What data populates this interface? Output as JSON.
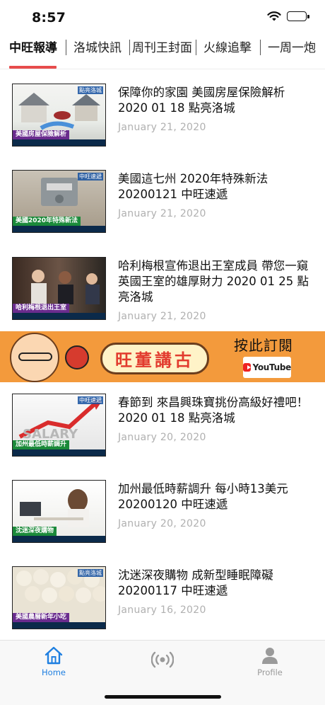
{
  "status": {
    "time": "8:57"
  },
  "tabs": [
    {
      "label": "中旺報導",
      "active": true
    },
    {
      "label": "洛城快訊",
      "active": false
    },
    {
      "label": "周刊王封面",
      "active": false
    },
    {
      "label": "火線追擊",
      "active": false
    },
    {
      "label": "一周一炮",
      "active": false
    }
  ],
  "articles": [
    {
      "title": "保障你的家園 美國房屋保險解析 2020 01 18 點亮洛城",
      "date": "January 21, 2020",
      "thumb_banner": "美國房屋保險解析"
    },
    {
      "title": "美國這七州 2020年特殊新法 20200121 中旺速遞",
      "date": "January 21, 2020",
      "thumb_banner": "美國2020年特殊新法"
    },
    {
      "title": "哈利梅根宣佈退出王室成員 帶您一窺英國王室的雄厚財力 2020 01 25 點亮洛城",
      "date": "January 21, 2020",
      "thumb_banner": "哈利梅根退出王室"
    },
    {
      "title": "春節到 來昌興珠寶挑份高級好禮吧！ 2020 01 18 點亮洛城",
      "date": "January 20, 2020",
      "thumb_banner": "加州最低時薪調升"
    },
    {
      "title": "加州最低時薪調升 每小時13美元 20200120 中旺速遞",
      "date": "January 20, 2020",
      "thumb_banner": "沈迷深夜購物"
    },
    {
      "title": "沈迷深夜購物 成新型睡眠障礙 20200117 中旺速遞",
      "date": "January 16, 2020",
      "thumb_banner": "美國農曆新年小吃"
    }
  ],
  "ad": {
    "title": "旺董講古",
    "subscribe": "按此訂閱",
    "youtube": "YouTube"
  },
  "nav": {
    "home": "Home",
    "live": "",
    "profile": "Profile"
  },
  "colors": {
    "accent": "#e74c4c",
    "nav_active": "#1f7fe0",
    "date": "#b0b0b0",
    "ad_bg": "#f39a3c"
  }
}
